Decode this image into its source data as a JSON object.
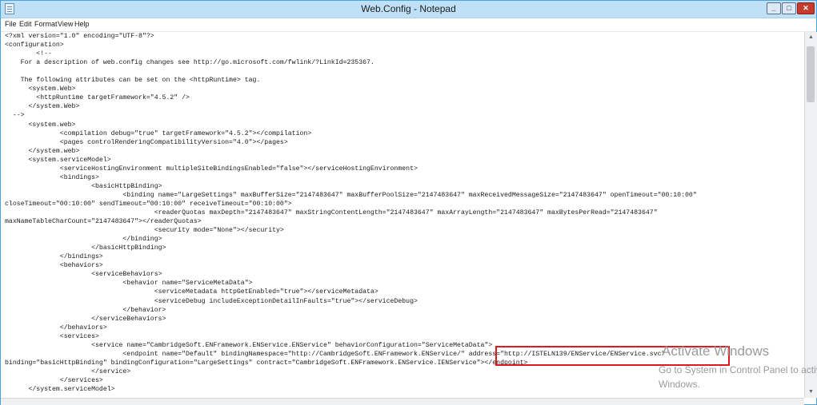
{
  "window": {
    "title": "Web.Config - Notepad",
    "controls": {
      "minimize": "_",
      "maximize": "□",
      "close": "✕"
    }
  },
  "menu": [
    "File",
    "Edit",
    "Format",
    "View",
    "Help"
  ],
  "lines": [
    "<?xml version=\"1.0\" encoding=\"UTF-8\"?>",
    "<configuration>",
    "        <!--",
    "    For a description of web.config changes see http://go.microsoft.com/fwlink/?LinkId=235367.",
    "",
    "    The following attributes can be set on the <httpRuntime> tag.",
    "      <system.Web>",
    "        <httpRuntime targetFramework=\"4.5.2\" />",
    "      </system.Web>",
    "  -->",
    "      <system.web>",
    "              <compilation debug=\"true\" targetFramework=\"4.5.2\"></compilation>",
    "              <pages controlRenderingCompatibilityVersion=\"4.0\"></pages>",
    "      </system.web>",
    "      <system.serviceModel>",
    "              <serviceHostingEnvironment multipleSiteBindingsEnabled=\"false\"></serviceHostingEnvironment>",
    "              <bindings>",
    "                      <basicHttpBinding>",
    "                              <binding name=\"LargeSettings\" maxBufferSize=\"2147483647\" maxBufferPoolSize=\"2147483647\" maxReceivedMessageSize=\"2147483647\" openTimeout=\"00:10:00\"",
    "closeTimeout=\"00:10:00\" sendTimeout=\"00:10:00\" receiveTimeout=\"00:10:00\">",
    "                                      <readerQuotas maxDepth=\"2147483647\" maxStringContentLength=\"2147483647\" maxArrayLength=\"2147483647\" maxBytesPerRead=\"2147483647\"",
    "maxNameTableCharCount=\"2147483647\"></readerQuotas>",
    "                                      <security mode=\"None\"></security>",
    "                              </binding>",
    "                      </basicHttpBinding>",
    "              </bindings>",
    "              <behaviors>",
    "                      <serviceBehaviors>",
    "                              <behavior name=\"ServiceMetaData\">",
    "                                      <serviceMetadata httpGetEnabled=\"true\"></serviceMetadata>",
    "                                      <serviceDebug includeExceptionDetailInFaults=\"true\"></serviceDebug>",
    "                              </behavior>",
    "                      </serviceBehaviors>",
    "              </behaviors>",
    "              <services>",
    "                      <service name=\"CambridgeSoft.ENFramework.ENService.ENService\" behaviorConfiguration=\"ServiceMetaData\">",
    "                              <endpoint name=\"Default\" bindingNamespace=\"http://CambridgeSoft.ENFramework.ENService/\" address=\"http://ISTELN139/ENService/ENService.svc\"",
    "binding=\"basicHttpBinding\" bindingConfiguration=\"LargeSettings\" contract=\"CambridgeSoft.ENFramework.ENService.IENService\"></endpoint>",
    "                      </service>",
    "              </services>",
    "      </system.serviceModel>"
  ],
  "watermark": {
    "line1": "Activate Windows",
    "line2": "Go to System in Control Panel to activate",
    "line3": "Windows."
  }
}
